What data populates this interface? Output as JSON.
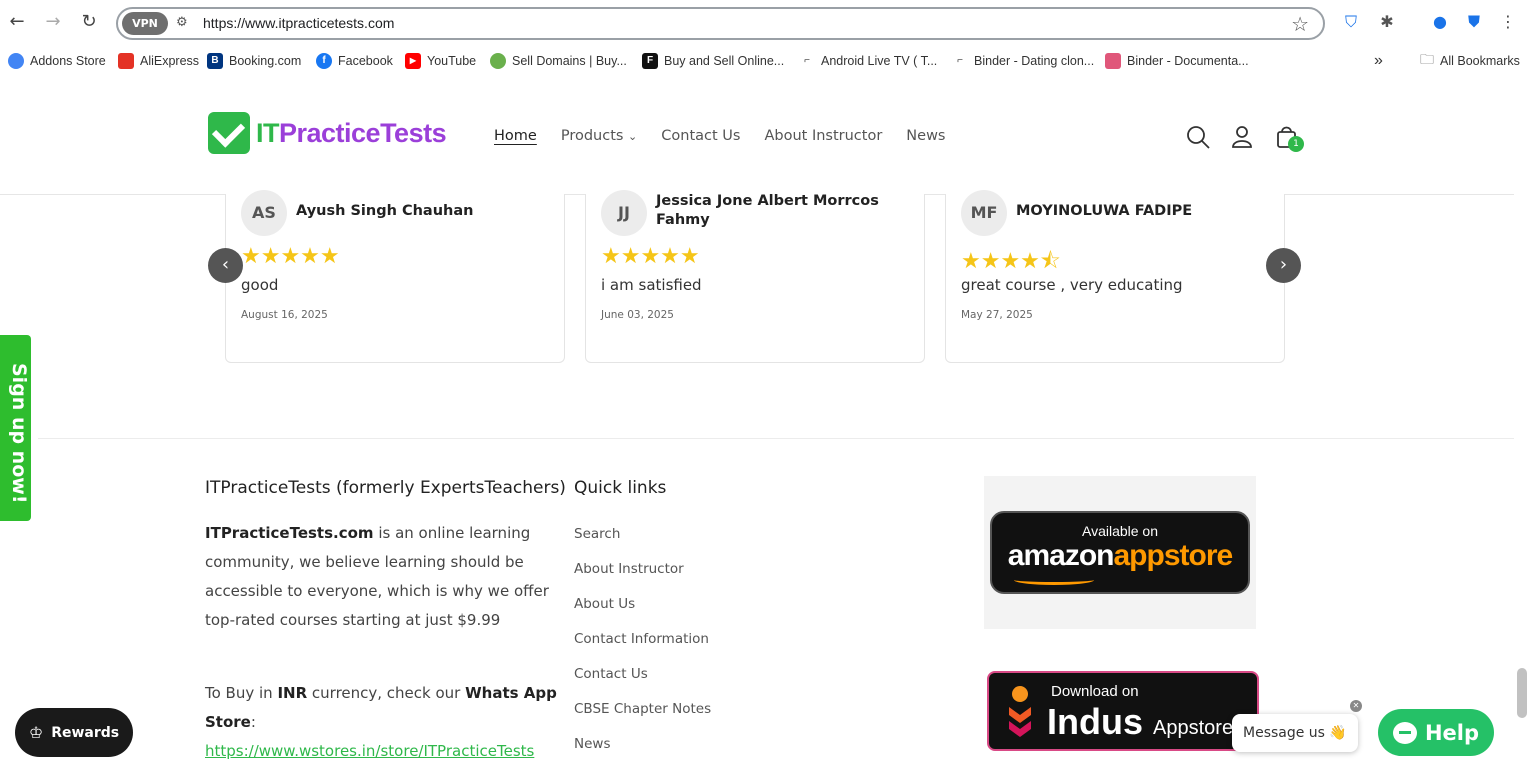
{
  "browser": {
    "url": "https://www.itpracticetests.com",
    "vpn_label": "VPN",
    "bookmarks": [
      {
        "label": "Addons Store",
        "color": "#4285f4",
        "glyph": "G"
      },
      {
        "label": "AliExpress",
        "color": "#e43225",
        "glyph": "A"
      },
      {
        "label": "Booking.com",
        "color": "#003580",
        "glyph": "B."
      },
      {
        "label": "Facebook",
        "color": "#1877f2",
        "glyph": "f"
      },
      {
        "label": "YouTube",
        "color": "#ff0000",
        "glyph": "▶"
      },
      {
        "label": "Sell Domains | Buy...",
        "color": "#6ab04c",
        "glyph": "◎"
      },
      {
        "label": "Buy and Sell Online...",
        "color": "#111111",
        "glyph": "F"
      },
      {
        "label": "Android Live TV ( T...",
        "color": "#555555",
        "glyph": "⌐"
      },
      {
        "label": "Binder - Dating clon...",
        "color": "#555555",
        "glyph": "⌐"
      },
      {
        "label": "Binder - Documenta...",
        "color": "#e0577a",
        "glyph": "◈"
      }
    ],
    "more_label": "»",
    "all_bookmarks": "All Bookmarks"
  },
  "header": {
    "logo_it": "IT",
    "logo_rest": "PracticeTests",
    "nav": [
      "Home",
      "Products",
      "Contact Us",
      "About Instructor",
      "News"
    ],
    "cart_count": "1"
  },
  "reviews": [
    {
      "initials": "AS",
      "name": "Ayush Singh Chauhan",
      "rating": 5,
      "stars": "★★★★★",
      "text": "good",
      "date": "August 16, 2025"
    },
    {
      "initials": "JJ",
      "name": "Jessica Jone Albert Morrcos Fahmy",
      "rating": 5,
      "stars": "★★★★★",
      "text": "i am satisfied",
      "date": "June 03, 2025"
    },
    {
      "initials": "MF",
      "name": "MOYINOLUWA FADIPE",
      "rating": 4.5,
      "stars": "★★★★⯪",
      "text": "great course , very educating",
      "date": "May 27, 2025"
    }
  ],
  "signup_tab": "Sign up now!",
  "footer": {
    "about_heading": "ITPracticeTests (formerly ExpertsTeachers)",
    "about_brand": "ITPracticeTests.com",
    "about_text": " is an online learning community, we believe learning should be accessible to everyone, which is why we offer top-rated courses starting at just $9.99",
    "inr_pre": "To Buy in ",
    "inr_bold": "INR",
    "inr_mid": " currency, check our ",
    "inr_store": "Whats App Store",
    "inr_colon": ":",
    "store_link": "https://www.wstores.in/store/ITPracticeTests",
    "quick_heading": "Quick links",
    "quick_links": [
      "Search",
      "About Instructor",
      "About Us",
      "Contact Information",
      "Contact Us",
      "CBSE Chapter Notes",
      "News"
    ],
    "amazon_small": "Available on",
    "amazon_big_1": "amazon",
    "amazon_big_2": "appstore",
    "indus_small": "Download on",
    "indus_big": "Indus",
    "indus_sub": "Appstore"
  },
  "widgets": {
    "rewards": "Rewards",
    "message": "Message us 👋",
    "help": "Help"
  }
}
